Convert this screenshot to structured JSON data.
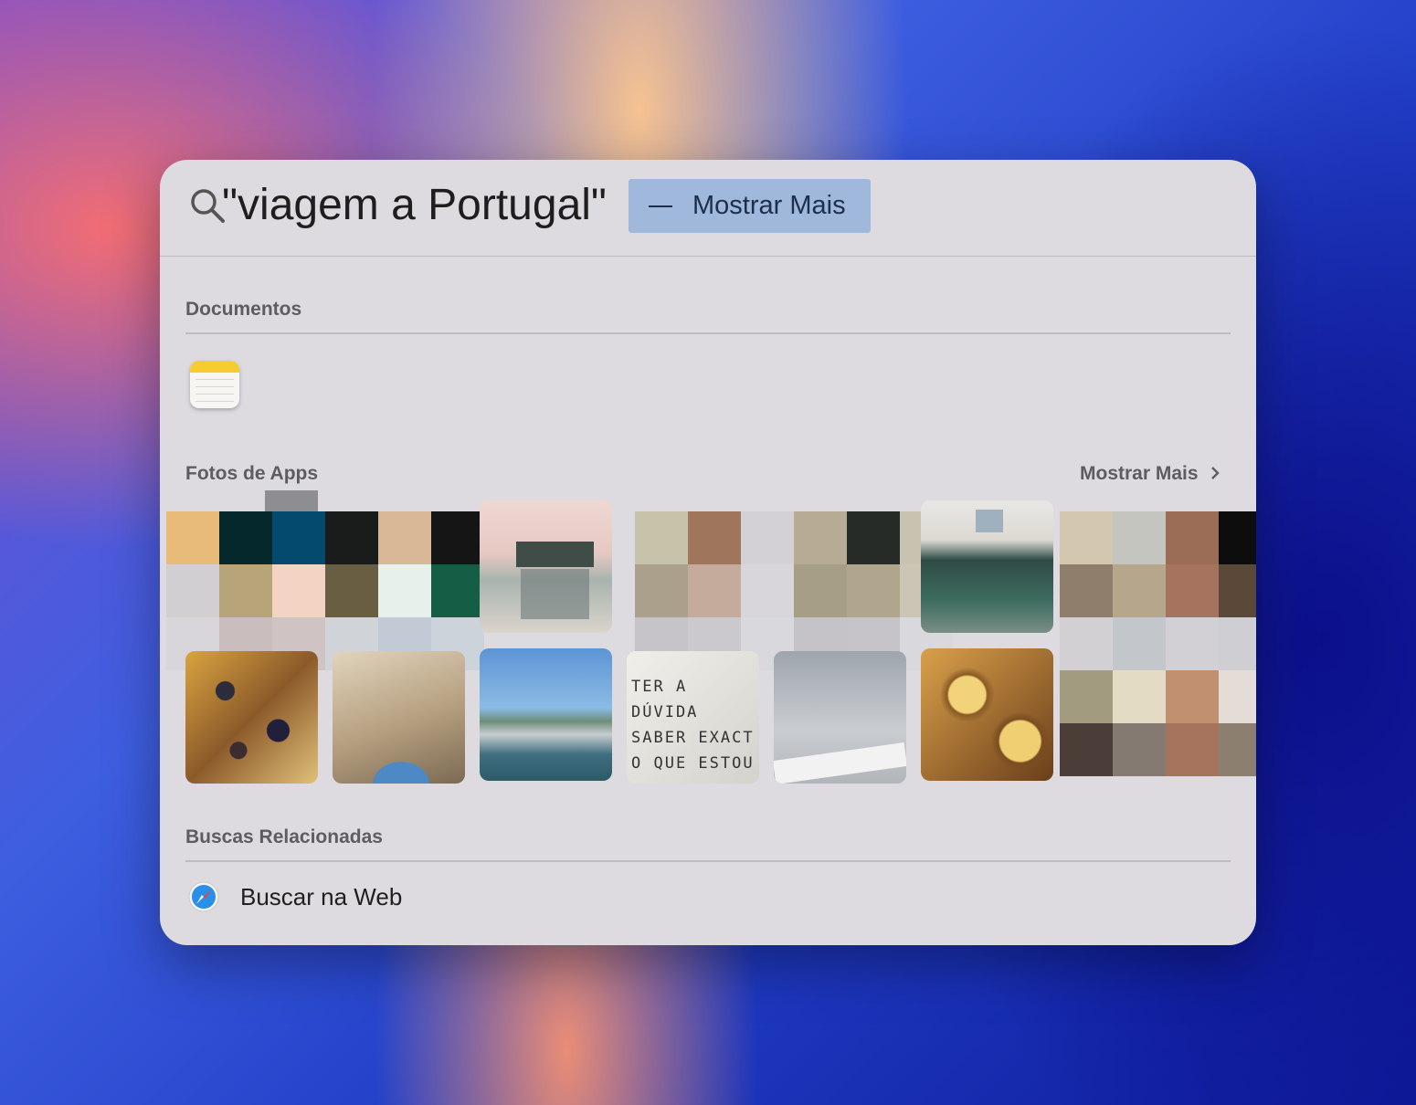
{
  "search": {
    "query": "\"viagem a Portugal\"",
    "show_more": "Mostrar Mais"
  },
  "documents": {
    "title": "Documentos",
    "items": [
      {
        "icon": "notes-icon"
      }
    ]
  },
  "photos": {
    "title": "Fotos de Apps",
    "show_more": "Mostrar Mais",
    "row2": [
      {
        "name": "photo-food"
      },
      {
        "name": "photo-arch"
      },
      {
        "name": "photo-marina"
      },
      {
        "name": "photo-tiles-text"
      },
      {
        "name": "photo-sky-sign"
      },
      {
        "name": "photo-pasteis"
      }
    ]
  },
  "related": {
    "title": "Buscas Relacionadas",
    "web_search": "Buscar na Web"
  },
  "colors": {
    "panel": "#dddbe0",
    "accent_highlight": "#9fb8dc"
  }
}
